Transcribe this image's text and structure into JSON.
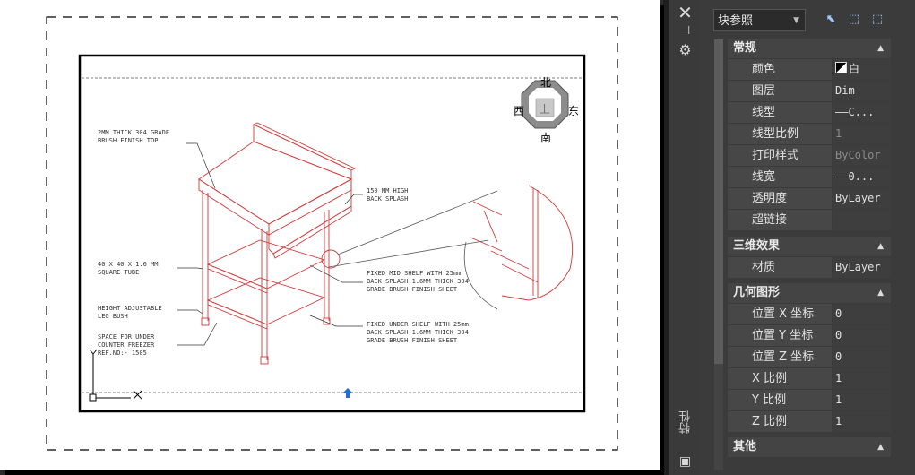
{
  "drawing": {
    "labels": {
      "top": "2MM THICK 304 GRADE\nBRUSH FINISH TOP",
      "splash": "150 MM HIGH\nBACK SPLASH",
      "tube": "40 X 40 X 1.6 MM\nSQUARE TUBE",
      "bush": "HEIGHT ADJUSTABLE\nLEG BUSH",
      "space": "SPACE FOR UNDER\nCOUNTER FREEZER\nREF.NO:- 1505",
      "mid_shelf": "FIXED MID SHELF WITH 25mm\nBACK SPLASH,1.6MM THICK 304\nGRADE BRUSH FINISH SHEET",
      "under_shelf": "FIXED UNDER SHELF WITH 25mm\nBACK SPLASH,1.6MM THICK 304\nGRADE BRUSH FINISH SHEET"
    },
    "viewcube": {
      "north": "北",
      "south": "南",
      "east": "东",
      "west": "西",
      "top": "上"
    }
  },
  "strip": {
    "close_icon": "close-icon",
    "pin_icon": "pin-icon",
    "settings_icon": "gear-icon",
    "label": "特性"
  },
  "panel": {
    "selector": "块参照",
    "sections": [
      {
        "title": "常规",
        "rows": [
          {
            "key": "颜色",
            "value": "白"
          },
          {
            "key": "图层",
            "value": "Dim"
          },
          {
            "key": "线型",
            "value": "——C..."
          },
          {
            "key": "线型比例",
            "value": "1"
          },
          {
            "key": "打印样式",
            "value": "ByColor"
          },
          {
            "key": "线宽",
            "value": "——0..."
          },
          {
            "key": "透明度",
            "value": "ByLayer"
          },
          {
            "key": "超链接",
            "value": ""
          }
        ]
      },
      {
        "title": "三维效果",
        "rows": [
          {
            "key": "材质",
            "value": "ByLayer"
          }
        ]
      },
      {
        "title": "几何图形",
        "rows": [
          {
            "key": "位置 X 坐标",
            "value": "0"
          },
          {
            "key": "位置 Y 坐标",
            "value": "0"
          },
          {
            "key": "位置 Z 坐标",
            "value": "0"
          },
          {
            "key": "X 比例",
            "value": "1"
          },
          {
            "key": "Y 比例",
            "value": "1"
          },
          {
            "key": "Z 比例",
            "value": "1"
          }
        ]
      },
      {
        "title": "其他",
        "rows": []
      }
    ]
  }
}
